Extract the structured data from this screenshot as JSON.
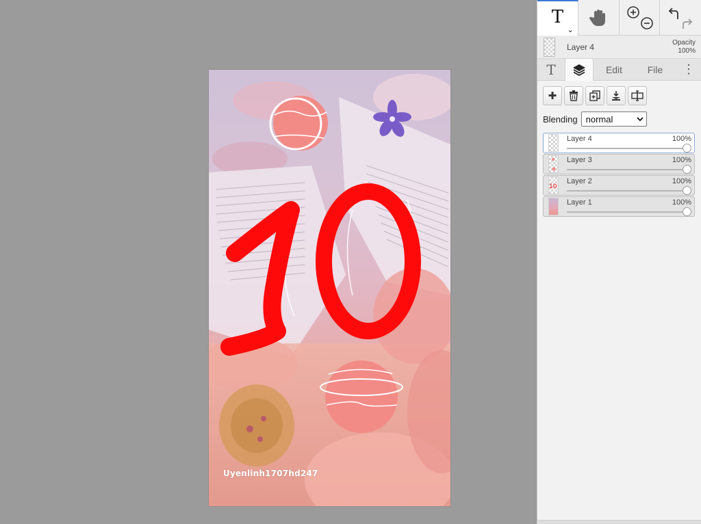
{
  "toolbar": {
    "tools": [
      {
        "name": "text-tool",
        "glyph": "T"
      },
      {
        "name": "hand-tool"
      },
      {
        "name": "zoom-tool"
      },
      {
        "name": "undo-redo"
      }
    ]
  },
  "current_layer": {
    "name": "Layer 4",
    "opacity_label": "Opacity",
    "opacity_value": "100%"
  },
  "tabs": {
    "type_glyph": "T",
    "edit": "Edit",
    "file": "File",
    "more": "⋮"
  },
  "layer_actions": [
    {
      "name": "add-layer",
      "glyph": "✚"
    },
    {
      "name": "delete-layer",
      "glyph": "🗑"
    },
    {
      "name": "duplicate-layer",
      "glyph": "⧉"
    },
    {
      "name": "merge-down",
      "glyph": "⤓"
    },
    {
      "name": "layer-properties",
      "glyph": "⊟"
    }
  ],
  "blending": {
    "label": "Blending",
    "value": "normal"
  },
  "layers": [
    {
      "name": "Layer 4",
      "opacity": "100%",
      "active": true
    },
    {
      "name": "Layer 3",
      "opacity": "100%",
      "active": false
    },
    {
      "name": "Layer 2",
      "opacity": "100%",
      "active": false
    },
    {
      "name": "Layer 1",
      "opacity": "100%",
      "active": false
    }
  ],
  "canvas": {
    "number_text": "10",
    "watermark": "Uyenlinh1707hd247",
    "colors": {
      "number": "#ff0a0a",
      "planet": "#f28a86",
      "flower": "#7a5cc8"
    }
  }
}
